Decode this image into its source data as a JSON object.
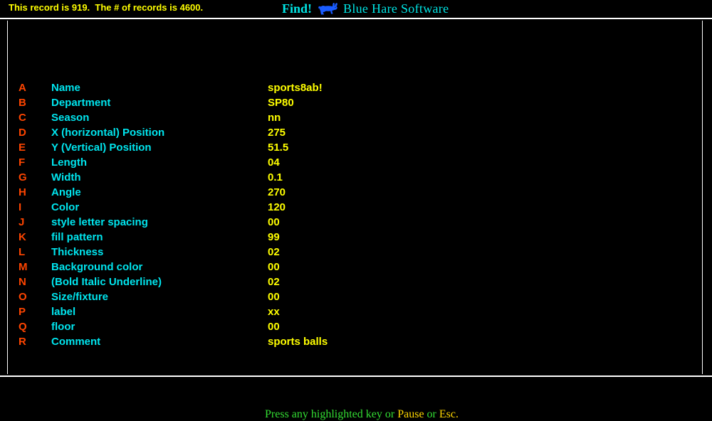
{
  "header": {
    "status_text": "This record is 919.  The # of records is 4600.",
    "record_number": "919",
    "record_total": "4600",
    "brand_find": "Find!",
    "brand_logo_icon": "blue-hare-icon",
    "brand_name": "Blue Hare Software"
  },
  "colors": {
    "background": "#000000",
    "frame": "#ffffff",
    "status": "#ffff00",
    "brand": "#00e5e5",
    "key": "#ff4500",
    "label": "#00e5ee",
    "value": "#ffff00",
    "footer_text": "#33dd33",
    "footer_highlight": "#ffd700",
    "logo": "#1a5cff"
  },
  "record": {
    "rows": [
      {
        "key": "A",
        "label": "Name",
        "value": "sports8ab!"
      },
      {
        "key": "B",
        "label": "Department",
        "value": "SP80"
      },
      {
        "key": "C",
        "label": "Season",
        "value": "nn"
      },
      {
        "key": "D",
        "label": "X (horizontal) Position",
        "value": "275"
      },
      {
        "key": "E",
        "label": "Y (Vertical) Position",
        "value": "51.5"
      },
      {
        "key": "F",
        "label": "Length",
        "value": "04"
      },
      {
        "key": "G",
        "label": "Width",
        "value": "0.1"
      },
      {
        "key": "H",
        "label": "Angle",
        "value": "270"
      },
      {
        "key": "I",
        "label": "Color",
        "value": "120"
      },
      {
        "key": "J",
        "label": "style letter spacing",
        "value": "00"
      },
      {
        "key": "K",
        "label": "fill pattern",
        "value": "99"
      },
      {
        "key": "L",
        "label": "Thickness",
        "value": "02"
      },
      {
        "key": "M",
        "label": "Background color",
        "value": "00"
      },
      {
        "key": "N",
        "label": "(Bold Italic Underline)",
        "value": "02"
      },
      {
        "key": "O",
        "label": "Size/fixture",
        "value": "00"
      },
      {
        "key": "P",
        "label": "label",
        "value": "xx"
      },
      {
        "key": "Q",
        "label": "floor",
        "value": "00"
      },
      {
        "key": "R",
        "label": "Comment",
        "value": "sports balls"
      }
    ]
  },
  "footer": {
    "segments": [
      {
        "text": "Press any highlighted key ",
        "highlight": false
      },
      {
        "text": "or ",
        "highlight": false
      },
      {
        "text": "Pause",
        "highlight": true
      },
      {
        "text": " or ",
        "highlight": false
      },
      {
        "text": "Esc.",
        "highlight": true
      }
    ],
    "full_text": "Press any highlighted key or Pause or Esc."
  }
}
